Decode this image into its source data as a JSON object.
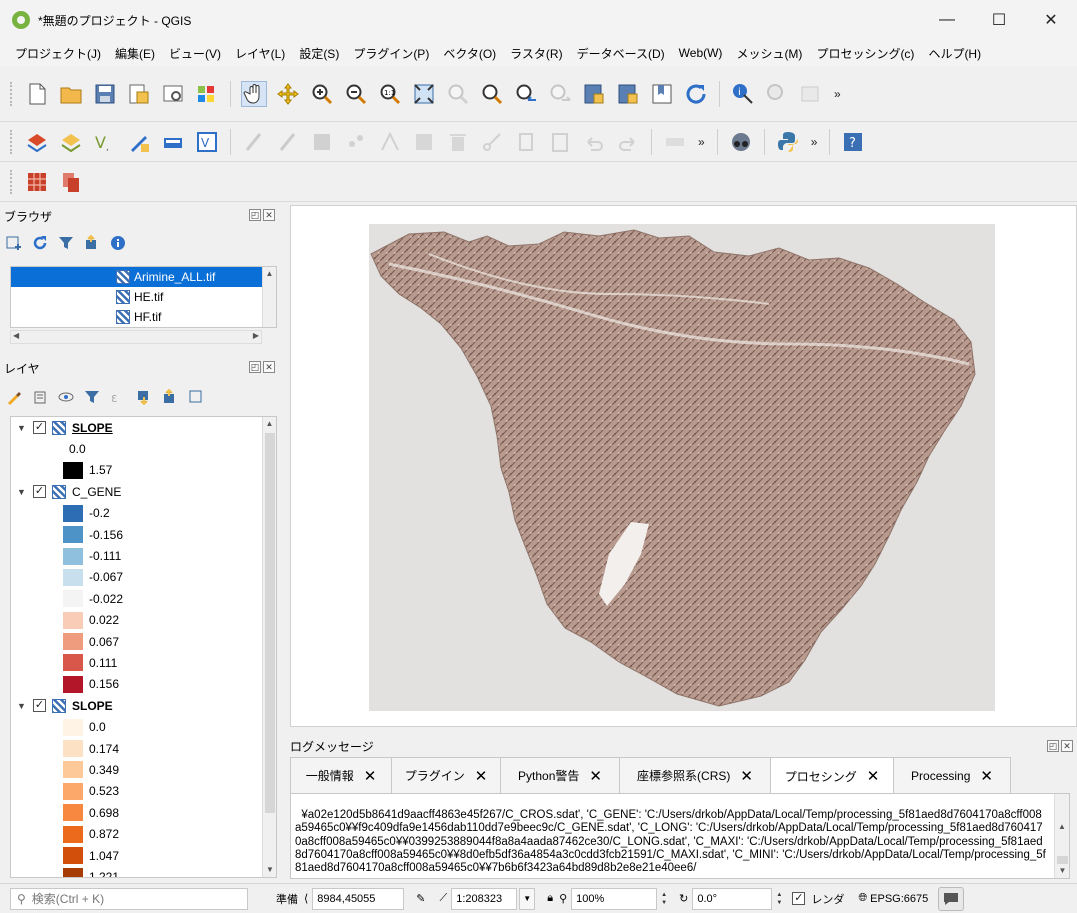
{
  "window": {
    "title": "*無題のプロジェクト - QGIS",
    "controls": [
      "—",
      "☐",
      "✕"
    ]
  },
  "menu": [
    "プロジェクト(J)",
    "編集(E)",
    "ビュー(V)",
    "レイヤ(L)",
    "設定(S)",
    "プラグイン(P)",
    "ベクタ(O)",
    "ラスタ(R)",
    "データベース(D)",
    "Web(W)",
    "メッシュ(M)",
    "プロセッシング(c)",
    "ヘルプ(H)"
  ],
  "toolbar": {
    "overflow": "»"
  },
  "browser": {
    "title": "ブラウザ",
    "items": [
      {
        "label": "Arimine_ALL.tif",
        "selected": true
      },
      {
        "label": "HE.tif",
        "selected": false
      },
      {
        "label": "HF.tif",
        "selected": false
      }
    ]
  },
  "layers": {
    "title": "レイヤ",
    "groups": [
      {
        "name": "SLOPE",
        "checked": "✓",
        "underline": true,
        "legend": [
          {
            "label": "0.0",
            "color": ""
          },
          {
            "label": "1.57",
            "color": "#000000"
          }
        ]
      },
      {
        "name": "C_GENE",
        "checked": "✓",
        "underline": false,
        "legend": [
          {
            "label": "-0.2",
            "color": "#2c6db3"
          },
          {
            "label": "-0.156",
            "color": "#4d93c8"
          },
          {
            "label": "-0.111",
            "color": "#8fc1de"
          },
          {
            "label": "-0.067",
            "color": "#c8e0ee"
          },
          {
            "label": "-0.022",
            "color": "#f4f4f4"
          },
          {
            "label": "0.022",
            "color": "#f8ccb7"
          },
          {
            "label": "0.067",
            "color": "#ef9b7e"
          },
          {
            "label": "0.111",
            "color": "#d9564a"
          },
          {
            "label": "0.156",
            "color": "#b31529"
          }
        ]
      },
      {
        "name": "SLOPE",
        "checked": "✓",
        "underline": false,
        "legend": [
          {
            "label": "0.0",
            "color": "#fff3e6"
          },
          {
            "label": "0.174",
            "color": "#fde1c4"
          },
          {
            "label": "0.349",
            "color": "#fdc998"
          },
          {
            "label": "0.523",
            "color": "#fca86a"
          },
          {
            "label": "0.698",
            "color": "#f88840"
          },
          {
            "label": "0.872",
            "color": "#ec6a1c"
          },
          {
            "label": "1.047",
            "color": "#d24f0b"
          },
          {
            "label": "1.221",
            "color": "#a83c07"
          }
        ]
      }
    ]
  },
  "log": {
    "title": "ログメッセージ",
    "tabs": [
      {
        "label": "一般情報",
        "active": false
      },
      {
        "label": "プラグイン",
        "active": false
      },
      {
        "label": "Python警告",
        "active": false
      },
      {
        "label": "座標参照系(CRS)",
        "active": false
      },
      {
        "label": "プロセシング",
        "active": true
      },
      {
        "label": "Processing",
        "active": false
      }
    ],
    "text": "¥a02e120d5b8641d9aacff4863e45f267/C_CROS.sdat', 'C_GENE': 'C:/Users/drkob/AppData/Local/Temp/processing_5f81aed8d7604170a8cff008a59465c0¥¥f9c409dfa9e1456dab110dd7e9beec9c/C_GENE.sdat', 'C_LONG': 'C:/Users/drkob/AppData/Local/Temp/processing_5f81aed8d7604170a8cff008a59465c0¥¥0399253889044f8a8a4aada87462ce30/C_LONG.sdat', 'C_MAXI': 'C:/Users/drkob/AppData/Local/Temp/processing_5f81aed8d7604170a8cff008a59465c0¥¥8d0efb5df36a4854a3c0cdd3fcb21591/C_MAXI.sdat', 'C_MINI': 'C:/Users/drkob/AppData/Local/Temp/processing_5f81aed8d7604170a8cff008a59465c0¥¥7b6b6f3423a64bd89d8b2e8e21e40ee6/"
  },
  "status": {
    "search_placeholder": "検索(Ctrl + K)",
    "coord_label": "準備",
    "coord_value": "8984,45055",
    "scale_value": "1:208323",
    "magnifier_value": "100%",
    "rotation_value": "0.0°",
    "render_label": "レンダ",
    "crs_label": "EPSG:6675"
  },
  "colors": {
    "selection": "#0a6fd6",
    "map_bg": "#e2e1e0"
  }
}
